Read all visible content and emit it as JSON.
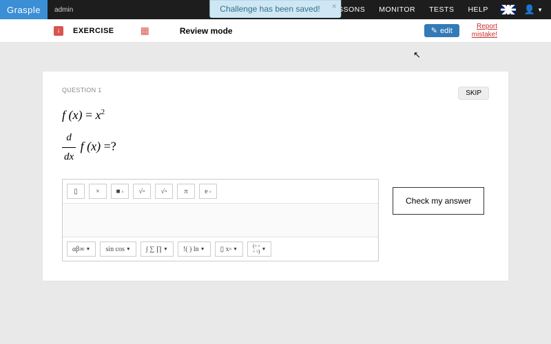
{
  "brand": "Grasple",
  "user_role": "admin",
  "nav": {
    "lessons": "LESSONS",
    "monitor": "MONITOR",
    "tests": "TESTS",
    "help": "HELP"
  },
  "toast": {
    "message": "Challenge has been saved!"
  },
  "subnav": {
    "exercise_label": "EXERCISE",
    "review_label": "Review mode",
    "edit_label": "edit",
    "report_line1": "Report",
    "report_line2": "mistake!"
  },
  "question": {
    "index_label": "QUESTION 1",
    "skip_label": "SKIP",
    "line1_lhs": "f (x)",
    "line1_eq": " = ",
    "line1_rhs_base": "x",
    "line1_rhs_exp": "2",
    "line2_frac_num": "d",
    "line2_frac_den": "dx",
    "line2_fx": "f (x)",
    "line2_eq": " =?",
    "check_label": "Check my answer"
  },
  "toolbar_top": {
    "frac": "▯",
    "times": "×",
    "power": "■",
    "power_sup": "▫",
    "sqrt": "√▫",
    "nroot": "√▫",
    "pi": "π",
    "e": "e",
    "e_sup": "▫"
  },
  "toolbar_bottom": {
    "greek": "αβ∞",
    "trig": "sin cos",
    "calc": "∫ ∑ ∏",
    "log": "!( ) ln",
    "sets": "▯ x▫",
    "matrix": "(▫ ▫\n▫ ▫)"
  }
}
